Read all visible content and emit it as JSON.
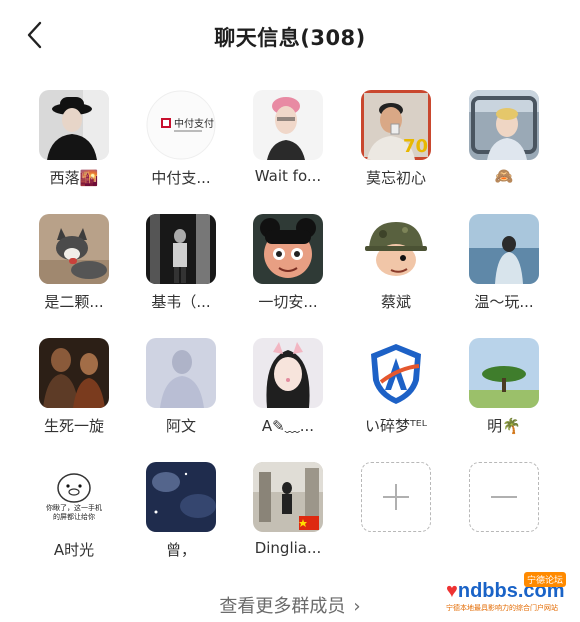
{
  "header": {
    "title": "聊天信息(308)"
  },
  "members": [
    {
      "name": "西落🌇",
      "icon": "avatar-hat-man"
    },
    {
      "name": "中付支...",
      "icon": "avatar-zhongfu-logo"
    },
    {
      "name": "Wait fo...",
      "icon": "avatar-pink-hair"
    },
    {
      "name": "莫忘初心",
      "icon": "avatar-man-70"
    },
    {
      "name": "🙈",
      "icon": "avatar-car-man"
    },
    {
      "name": "是二颗...",
      "icon": "avatar-husky-dog"
    },
    {
      "name": "基韦（...",
      "icon": "avatar-street-photo"
    },
    {
      "name": "一切安...",
      "icon": "avatar-cartoon-girl"
    },
    {
      "name": "蔡斌",
      "icon": "avatar-soldier-cartoon"
    },
    {
      "name": "温～玩...",
      "icon": "avatar-sea-view"
    },
    {
      "name": "生死一旋",
      "icon": "avatar-warriors"
    },
    {
      "name": "阿文",
      "icon": "avatar-blurry-person"
    },
    {
      "name": "A✎﹏...",
      "icon": "avatar-cat-filter-girl"
    },
    {
      "name": "い碎梦ᵀᴱᴸ",
      "icon": "avatar-shield-logo"
    },
    {
      "name": "明🌴",
      "icon": "avatar-tree-landscape"
    },
    {
      "name": "A时光",
      "icon": "avatar-pig-meme"
    },
    {
      "name": "曾，",
      "icon": "avatar-night-sky"
    },
    {
      "name": "Dinglia...",
      "icon": "avatar-street-cn-flag"
    }
  ],
  "pig_meme_text": "你瞅了，这一手机的屏都让给你",
  "zhongfu_text": "中付支付",
  "seventy_text": "70",
  "footer": {
    "more_label": "查看更多群成员",
    "more_arrow": "›"
  },
  "watermark": {
    "logo": "ndbbs.com",
    "tag": "宁德论坛",
    "sub": "宁德本地最具影响力的综合门户网站"
  },
  "colors": {
    "background": "#ffffff",
    "title": "#1f1f1f",
    "name": "#333333",
    "muted": "#6b6b6b",
    "dashed": "#b8b8b8"
  }
}
